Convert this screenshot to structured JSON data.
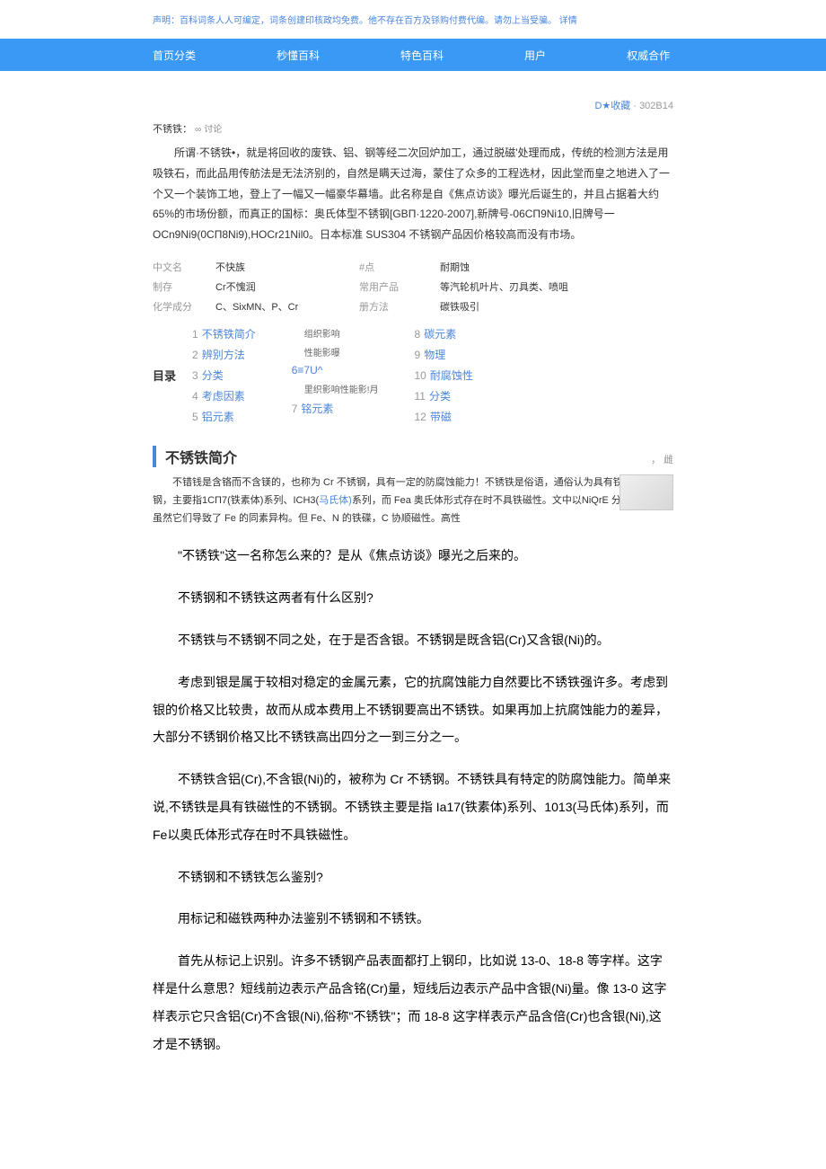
{
  "disclaimer": {
    "text": "声明：百科词条人人可编定，词条创建印核政均免费。他不存在百方及铩购付费代编。请勿上当受骗。",
    "link": "详情"
  },
  "nav": {
    "items": [
      "首页分类",
      "秒懂百科",
      "特色百科",
      "用户",
      "权威合作"
    ]
  },
  "bookmark": {
    "icon": "D★",
    "label": "收藏",
    "count": "302B14"
  },
  "entry": {
    "title": "不锈铁：",
    "discuss_icon": "∞",
    "discuss": "讨论"
  },
  "intro": "所谓·不锈铁•，就是将回收的废铁、铝、钢等经二次回炉加工，通过脱磁'处理而成，传统的检测方法是用吸铁石，而此品用传舫法是无法济别的，自然是瞒天过海，蒙住了众多的工程选材，因此堂而皇之地进入了一个又一个装饰工地，登上了一幅又一幅豪华幕墙。此名称是自《焦点访谈》曝光后诞生的，并且占据着大约 65%的市场份额，而真正的国标：奥氏体型不锈钢[GBΠ·1220-2007],新牌号-06CΠ9Ni10,旧牌号一 OCn9Ni9(0CΠ8Ni9),HOCr21Nil0。日本标准 SUS304 不锈钢产品因价格较高而没有市场。",
  "info": {
    "rows": [
      {
        "l1": "中文名",
        "v1": "不快族",
        "l2": "#点",
        "v2": "耐期蚀"
      },
      {
        "l1": "制存",
        "v1": "Cr不愧润",
        "l2": "常用产品",
        "v2": "等汽轮机叶片、刃具类、喷咀"
      },
      {
        "l1": "化学成分",
        "v1": "C、SixMN、P、Cr",
        "l2": "册方法",
        "v2": "碳铁吸引"
      }
    ]
  },
  "toc": {
    "label": "目录",
    "col1": [
      "不锈铁简介",
      "辨别方法",
      "分类",
      "考虑因素",
      "铝元素"
    ],
    "col2_top": [
      "组织影响",
      "性能影曝"
    ],
    "col2_mid": "6≡7U^",
    "col2_sub": "里织影响性能影!月",
    "col2_bottom": "铭元素",
    "col3": [
      "碳元素",
      "物理",
      "耐腐蚀性",
      "分类",
      "带磁"
    ]
  },
  "section": {
    "title": "不锈铁简介",
    "edit": "， 雌",
    "p1_a": "不错钱是含铬而不含镁的，也称为 Cr 不锈钢，具有一定的防腐蚀能力！不锈铁是俗语，通俗认为具有铁磁性的不锈钢，主要指1CΠ7(铁素体)系列、ICH3(",
    "p1_link": "马氏体)",
    "p1_b": "系列，而 Fea 奥氏体形式存在时不具铁磁性。文中以NiQrE 分容易误会，虽然它们导致了 Fe 的同素异构。但 Fe、N 的铁碟，C 协顺磁性。高性"
  },
  "body": {
    "p1": "\"不锈铁\"这一名称怎么来的？是从《焦点访谈》曝光之后来的。",
    "p2": "不锈钢和不锈铁这两者有什么区别?",
    "p3": "不锈铁与不锈钢不同之处，在于是否含银。不锈钢是既含铝(Cr)又含银(Ni)的。",
    "p4": "考虑到银是属于较相对稳定的金属元素，它的抗腐蚀能力自然要比不锈铁强许多。考虑到银的价格又比较贵，故而从成本费用上不锈钢要高出不锈铁。如果再加上抗腐蚀能力的差异，大部分不锈钢价格又比不锈铁高出四分之一到三分之一。",
    "p5": "不锈铁含铝(Cr),不含银(Ni)的，被称为 Cr 不锈钢。不锈铁具有特定的防腐蚀能力。简单来说,不锈铁是具有铁磁性的不锈钢。不锈铁主要是指 Ia17(铁素体)系列、1013(马氏体)系列，而 Fe以奥氏体形式存在时不具铁磁性。",
    "p6": "不锈钢和不锈铁怎么鉴别?",
    "p7": "用标记和磁铁两种办法鉴别不锈钢和不锈铁。",
    "p8": "首先从标记上识别。许多不锈钢产品表面都打上钢印，比如说 13-0、18-8 等字样。这字样是什么意思？短线前边表示产品含铭(Cr)量，短线后边表示产品中含银(Ni)量。像 13-0 这字样表示它只含铝(Cr)不含银(Ni),俗称\"不锈铁\"；而 18-8 这字样表示产品含倍(Cr)也含银(Ni),这才是不锈钢。"
  }
}
